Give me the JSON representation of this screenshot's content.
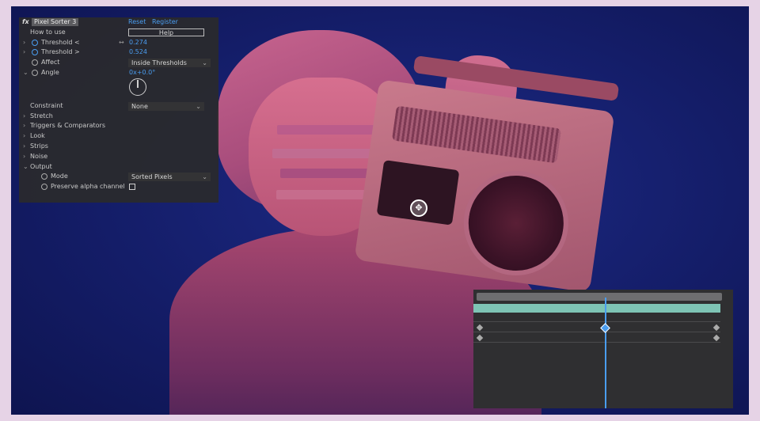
{
  "effect_panel": {
    "fx_badge": "fx",
    "effect_name": "Pixel Sorter 3",
    "reset_link": "Reset",
    "register_link": "Register",
    "how_to_use_label": "How to use",
    "help_button": "Help",
    "threshold_lt_label": "Threshold <",
    "threshold_lt_value": "0.274",
    "threshold_gt_label": "Threshold >",
    "threshold_gt_value": "0.524",
    "affect_label": "Affect",
    "affect_value": "Inside Thresholds",
    "angle_label": "Angle",
    "angle_value": "0x+0.0°",
    "constraint_label": "Constraint",
    "constraint_value": "None",
    "groups": [
      "Stretch",
      "Triggers & Comparators",
      "Look",
      "Strips",
      "Noise",
      "Output"
    ],
    "mode_label": "Mode",
    "mode_value": "Sorted Pixels",
    "preserve_alpha_label": "Preserve alpha channel"
  },
  "icons": {
    "stopwatch": "stopwatch-icon",
    "expand": "chevron-right-icon",
    "collapse": "chevron-down-icon",
    "dropdown": "chevron-down-icon",
    "anchor": "anchor-point-icon",
    "keyframe": "keyframe-diamond-icon"
  },
  "colors": {
    "accent": "#4a9df0",
    "panel_bg": "#2a2a2c",
    "timeline_bar": "#7ec4b5"
  }
}
